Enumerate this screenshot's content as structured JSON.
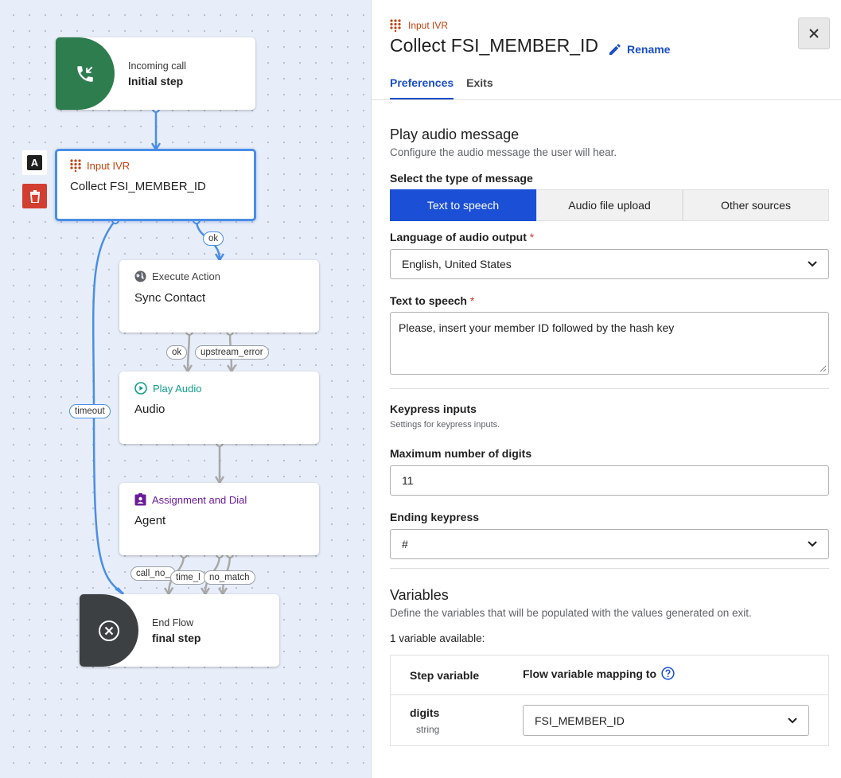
{
  "canvas": {
    "side_tools": {
      "avatar_letter": "A"
    },
    "nodes": {
      "incoming": {
        "type": "Incoming call",
        "name": "Initial step"
      },
      "input_ivr": {
        "type": "Input IVR",
        "name": "Collect FSI_MEMBER_ID"
      },
      "execute_action": {
        "type": "Execute Action",
        "name": "Sync Contact"
      },
      "play_audio": {
        "type": "Play Audio",
        "name": "Audio"
      },
      "assignment": {
        "type": "Assignment and Dial",
        "name": "Agent"
      },
      "end_flow": {
        "type": "End Flow",
        "name": "final step"
      }
    },
    "exits": {
      "ivr_ok": "ok",
      "ivr_timeout": "timeout",
      "exec_ok": "ok",
      "exec_error": "upstream_error",
      "agent_call_no": "call_no_",
      "agent_time": "time_l",
      "agent_no_match": "no_match"
    },
    "colors": {
      "incoming": "#2e7d4f",
      "end_flow": "#3c4043",
      "ivr": "#c2410c",
      "play_audio": "#0f9d8a",
      "assignment": "#6a1b9a",
      "wire_active": "#4a8ee6",
      "wire": "#a8a8a8",
      "delete": "#d23f31"
    }
  },
  "panel": {
    "type_label": "Input IVR",
    "title": "Collect FSI_MEMBER_ID",
    "rename_label": "Rename",
    "tabs": [
      "Preferences",
      "Exits"
    ],
    "play_audio": {
      "heading": "Play audio message",
      "description": "Configure the audio message the user will hear.",
      "message_type_label": "Select the type of message",
      "message_types": [
        "Text to speech",
        "Audio file upload",
        "Other sources"
      ],
      "language_label": "Language of audio output",
      "language_value": "English, United States",
      "tts_label": "Text to speech",
      "tts_value": "Please, insert your member ID followed by the hash key"
    },
    "keypress": {
      "heading": "Keypress inputs",
      "description": "Settings for keypress inputs.",
      "max_digits_label": "Maximum number of digits",
      "max_digits_value": "11",
      "ending_label": "Ending keypress",
      "ending_value": "#"
    },
    "variables": {
      "heading": "Variables",
      "description": "Define the variables that will be populated with the values generated on exit.",
      "count_text": "1 variable available:",
      "col_step": "Step variable",
      "col_flow": "Flow variable mapping to",
      "rows": [
        {
          "name": "digits",
          "type": "string",
          "mapping": "FSI_MEMBER_ID"
        }
      ]
    },
    "accent_color": "#1a4fd6",
    "required_color": "#d93025"
  }
}
